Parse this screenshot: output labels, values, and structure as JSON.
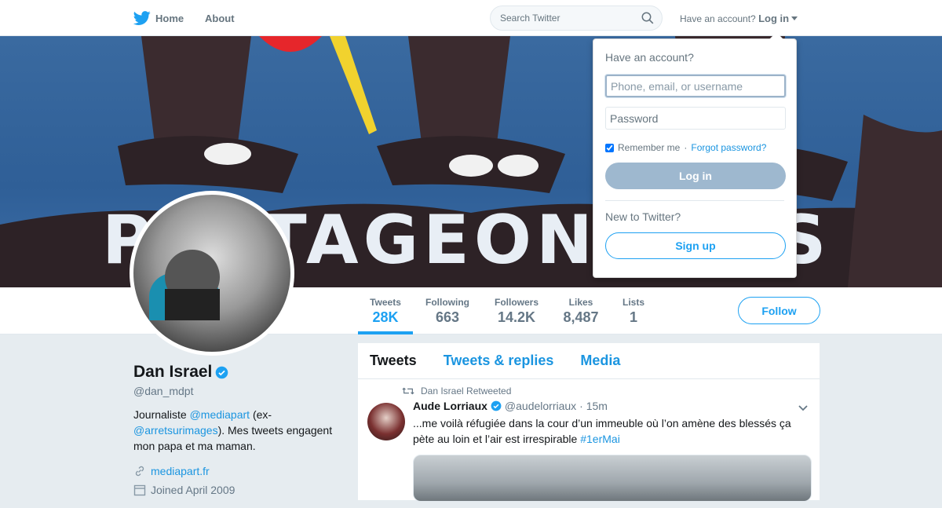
{
  "topbar": {
    "home_label": "Home",
    "about_label": "About",
    "search_placeholder": "Search Twitter",
    "have_account": "Have an account?",
    "login_label": "Log in"
  },
  "banner": {
    "text": "PARTAGEONS LES RICHESSES"
  },
  "profile": {
    "name": "Dan Israel",
    "handle": "@dan_mdpt",
    "bio_1": "Journaliste ",
    "bio_link_1": "@mediapart",
    "bio_2": " (ex-",
    "bio_link_2": "@arretsurimages",
    "bio_3": "). Mes tweets engagent mon papa et ma maman.",
    "website": "mediapart.fr",
    "joined": "Joined April 2009"
  },
  "stats": [
    {
      "label": "Tweets",
      "value": "28K"
    },
    {
      "label": "Following",
      "value": "663"
    },
    {
      "label": "Followers",
      "value": "14.2K"
    },
    {
      "label": "Likes",
      "value": "8,487"
    },
    {
      "label": "Lists",
      "value": "1"
    }
  ],
  "follow_label": "Follow",
  "timeline": {
    "tabs": [
      "Tweets",
      "Tweets & replies",
      "Media"
    ],
    "tweet": {
      "retweeted_by": "Dan Israel Retweeted",
      "author": "Aude Lorriaux",
      "handle": "@audelorriaux",
      "time": "· 15m",
      "text": "...me voilà réfugiée dans la cour d’un immeuble où l’on amène des blessés ça pète au loin et l’air est irrespirable ",
      "hashtag": "#1erMai"
    }
  },
  "login_dropdown": {
    "title": "Have an account?",
    "username_placeholder": "Phone, email, or username",
    "password_placeholder": "Password",
    "remember_label": "Remember me",
    "separator": " · ",
    "forgot_label": "Forgot password?",
    "login_button": "Log in",
    "new_to_twitter": "New to Twitter?",
    "signup_button": "Sign up"
  },
  "colors": {
    "brand_blue": "#1da1f2",
    "link_blue": "#1b95e0",
    "login_button_bg": "#9eb8cf",
    "background": "#e6ecf0"
  }
}
